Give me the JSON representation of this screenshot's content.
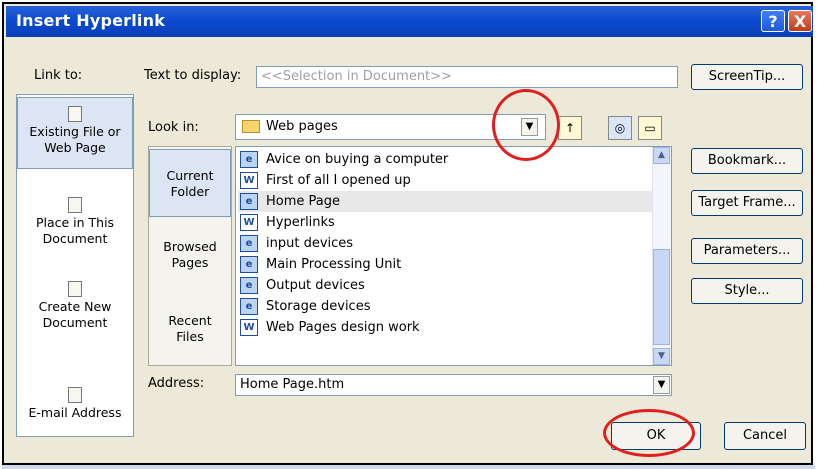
{
  "window": {
    "title": "Insert Hyperlink",
    "help_glyph": "?",
    "close_glyph": "X"
  },
  "link_to": {
    "label": "Link to:",
    "items": [
      {
        "label_line1": "Existing File or",
        "label_line2": "Web Page",
        "selected": true
      },
      {
        "label_line1": "Place in This",
        "label_line2": "Document",
        "selected": false
      },
      {
        "label_line1": "Create New",
        "label_line2": "Document",
        "selected": false
      },
      {
        "label_line1": "E-mail Address",
        "label_line2": "",
        "selected": false
      }
    ]
  },
  "text_to_display": {
    "label": "Text to display:",
    "value": "<<Selection in Document>>"
  },
  "screentip_button": "ScreenTip...",
  "look_in": {
    "label": "Look in:",
    "value": "Web pages"
  },
  "places": [
    {
      "line1": "Current",
      "line2": "Folder",
      "selected": true
    },
    {
      "line1": "Browsed",
      "line2": "Pages",
      "selected": false
    },
    {
      "line1": "Recent",
      "line2": "Files",
      "selected": false
    }
  ],
  "files": [
    {
      "name": "Avice on buying a computer",
      "type": "web"
    },
    {
      "name": "First of all I opened up",
      "type": "doc"
    },
    {
      "name": "Home Page",
      "type": "web",
      "selected": true
    },
    {
      "name": "Hyperlinks",
      "type": "doc"
    },
    {
      "name": "input devices",
      "type": "web"
    },
    {
      "name": "Main Processing Unit",
      "type": "web"
    },
    {
      "name": "Output devices",
      "type": "web"
    },
    {
      "name": "Storage devices",
      "type": "web"
    },
    {
      "name": "Web Pages design work",
      "type": "doc"
    }
  ],
  "side_buttons": {
    "bookmark": "Bookmark...",
    "target_frame": "Target Frame...",
    "parameters": "Parameters...",
    "style": "Style..."
  },
  "address": {
    "label": "Address:",
    "value": "Home Page.htm"
  },
  "ok_button": "OK",
  "cancel_button": "Cancel",
  "colors": {
    "titlebar": "#0a4ad0",
    "annotation": "#e21f1f",
    "dialog_bg": "#ece9d8"
  }
}
